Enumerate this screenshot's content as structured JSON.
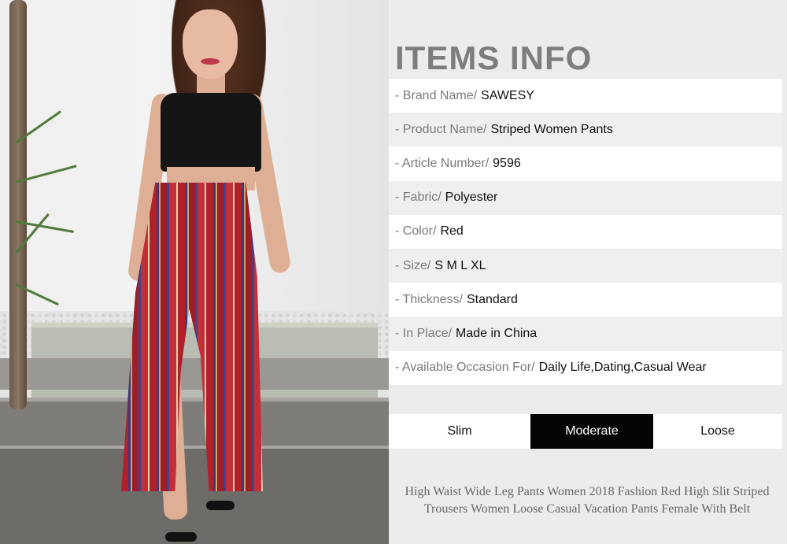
{
  "items_info": {
    "title": "ITEMS INFO",
    "rows": [
      {
        "label": "- Brand Name/",
        "value": "SAWESY"
      },
      {
        "label": "- Product Name/",
        "value": "Striped Women Pants"
      },
      {
        "label": "- Article Number/",
        "value": "9596"
      },
      {
        "label": "- Fabric/",
        "value": "Polyester"
      },
      {
        "label": "- Color/",
        "value": "Red"
      },
      {
        "label": "- Size/",
        "value": "S M L XL"
      },
      {
        "label": "- Thickness/",
        "value": "Standard"
      },
      {
        "label": "- In Place/",
        "value": "Made in China"
      },
      {
        "label": "- Available Occasion For/",
        "value": "Daily Life,Dating,Casual Wear"
      }
    ]
  },
  "fit": {
    "options": [
      "Slim",
      "Moderate",
      "Loose"
    ],
    "selected": "Moderate"
  },
  "description": "High Waist Wide Leg Pants Women 2018 Fashion Red High Slit Striped Trousers Women Loose Casual Vacation Pants Female With Belt",
  "colors": {
    "pants_red": "#b2202a",
    "selected_fit_bg": "#050505",
    "title_gray": "#7d7d7d"
  }
}
